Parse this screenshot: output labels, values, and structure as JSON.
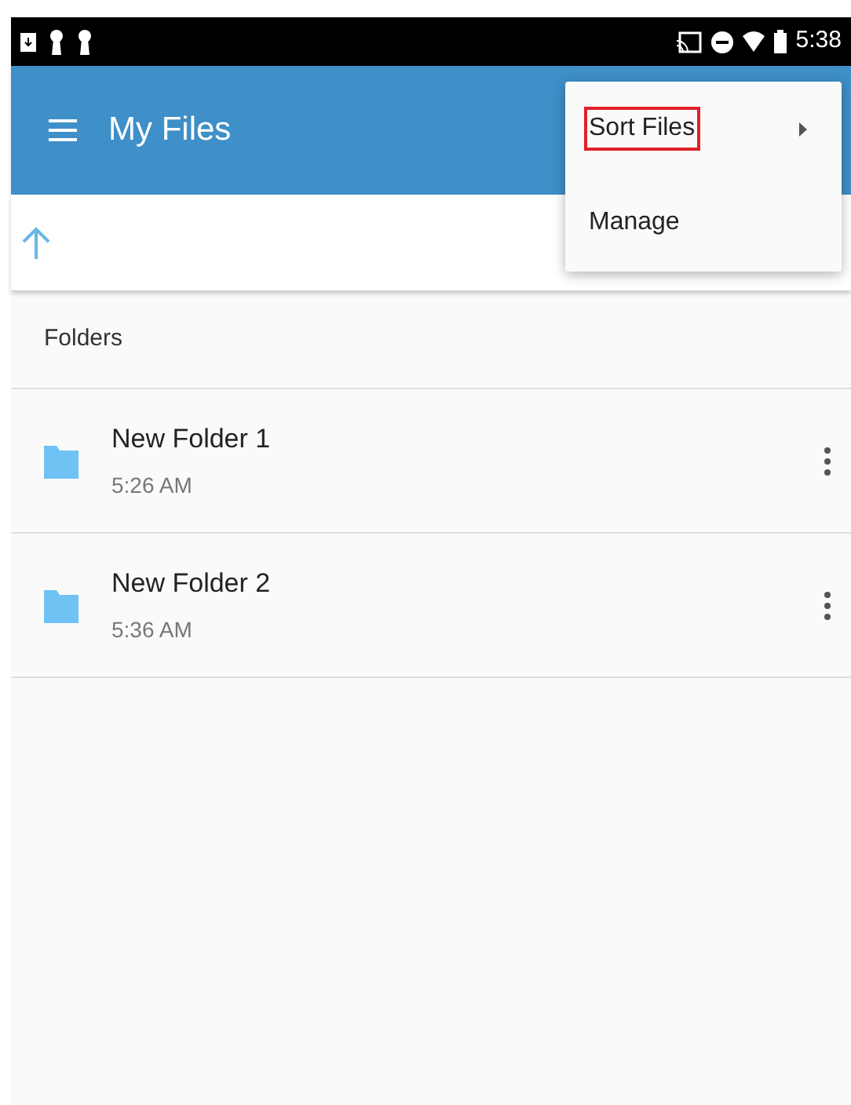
{
  "status_bar": {
    "time": "5:38"
  },
  "app_bar": {
    "title": "My Files"
  },
  "section": {
    "title": "Folders"
  },
  "folders": [
    {
      "name": "New Folder 1",
      "time": "5:26 AM"
    },
    {
      "name": "New Folder 2",
      "time": "5:36 AM"
    }
  ],
  "menu": {
    "items": [
      {
        "label": "Sort Files",
        "submenu": true,
        "highlighted": true
      },
      {
        "label": "Manage",
        "submenu": false,
        "highlighted": false
      }
    ]
  }
}
